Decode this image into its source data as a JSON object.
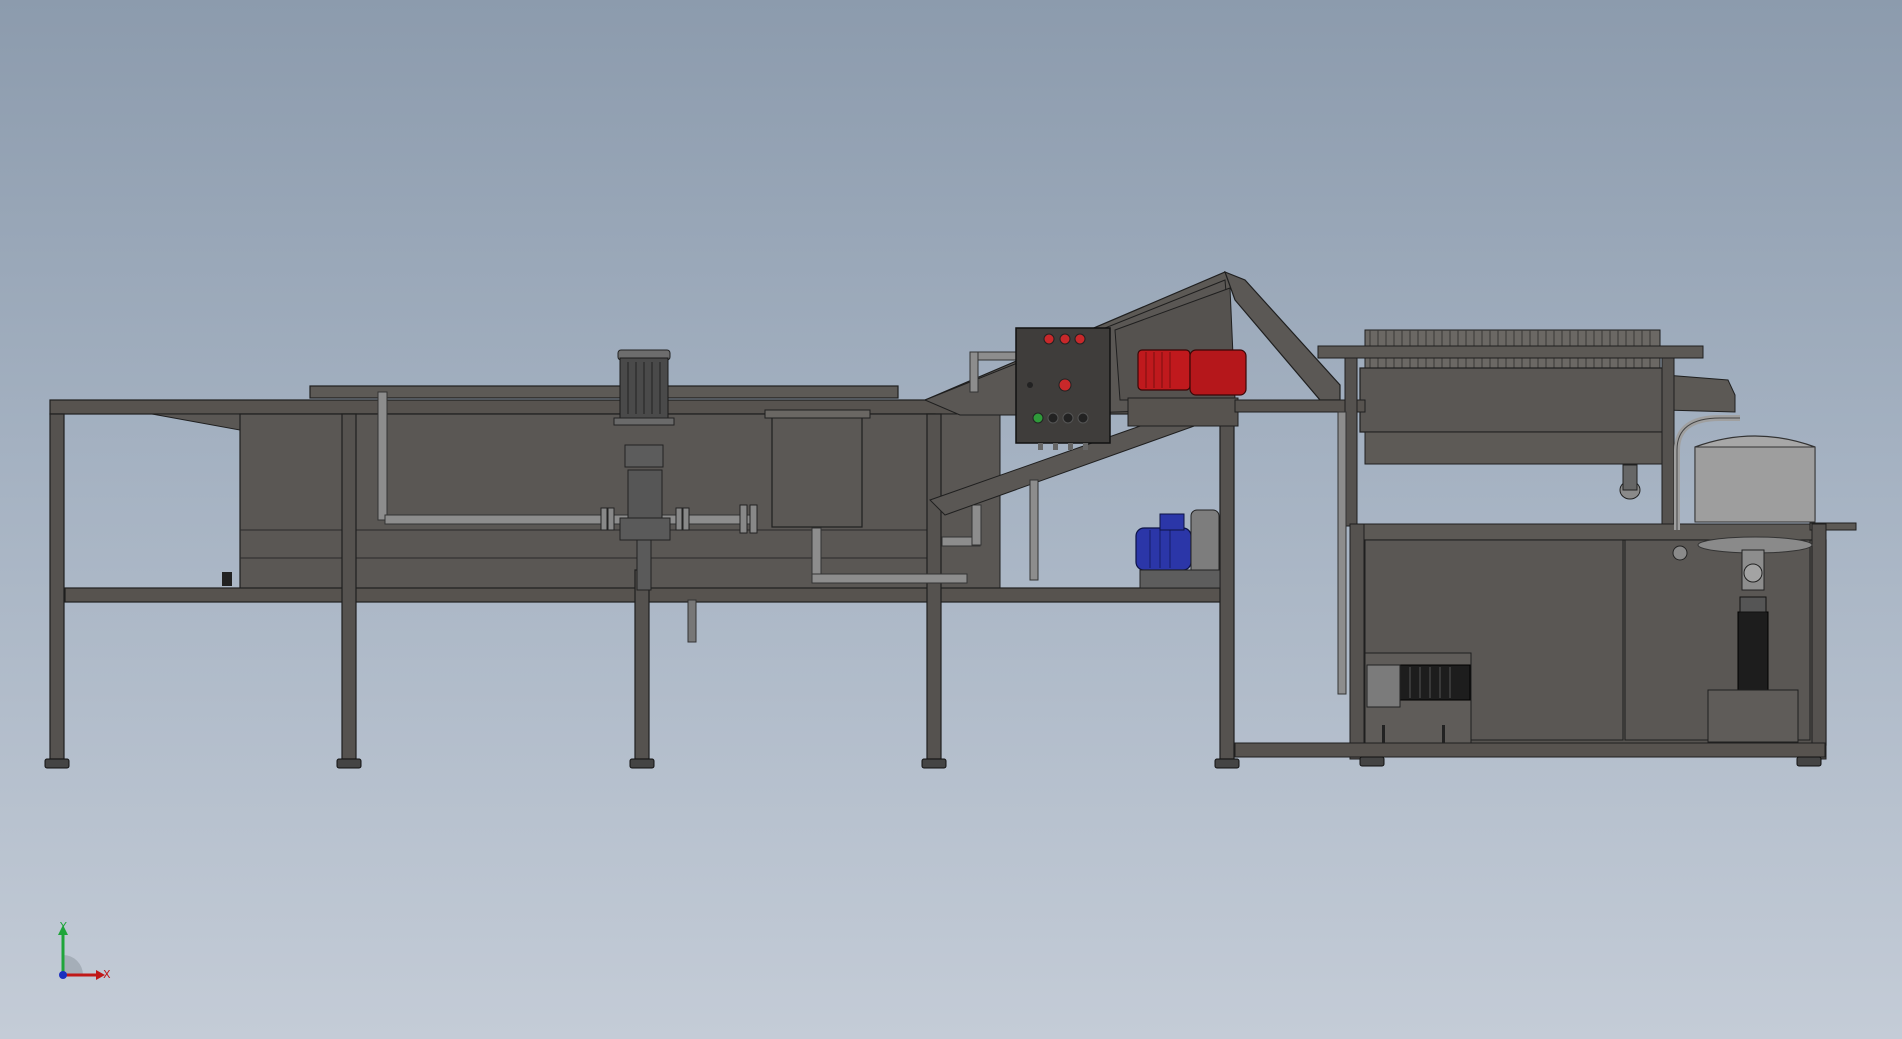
{
  "viewport": {
    "background_top": "#8c9bad",
    "background_bottom": "#c4ccd7"
  },
  "model": {
    "frame_color": "#55524f",
    "tank_color": "#5a5754",
    "red_motor_color": "#c0191d",
    "blue_motor_color": "#2b36a8",
    "control_buttons_red": "#c8282a",
    "control_buttons_green": "#2f9a3a",
    "separator_color": "#9c9c9c"
  },
  "triad": {
    "x_label": "X",
    "y_label": "Y",
    "x_color": "#c01818",
    "y_color": "#1fa53a",
    "z_color": "#1a2fbf"
  }
}
